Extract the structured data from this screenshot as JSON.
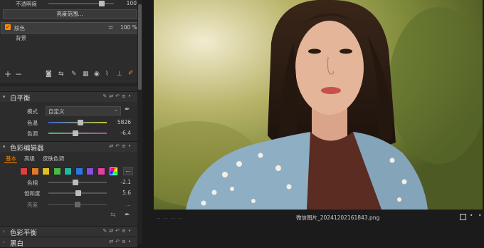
{
  "layer_panel": {
    "opacity_label": "不透明度",
    "opacity_value": "100",
    "opacity_fraction": 0.85,
    "luma_range_button": "亮度范围...",
    "layers": [
      {
        "name": "肤色",
        "opacity": "100 %",
        "selected": true
      },
      {
        "name": "背景",
        "selected": false
      }
    ]
  },
  "white_balance": {
    "title": "白平衡",
    "mode_label": "模式",
    "mode_value": "自定义",
    "temp_label": "色温",
    "temp_value": "5826",
    "temp_fraction": 0.55,
    "tint_label": "色调",
    "tint_value": "-6.4",
    "tint_fraction": 0.46
  },
  "color_editor": {
    "title": "色彩编辑器",
    "tabs": [
      "基本",
      "高级",
      "皮肤色调"
    ],
    "swatches": [
      "#e04040",
      "#e07a28",
      "#e0c020",
      "#4cb848",
      "#20b8a0",
      "#2c78e0",
      "#8c4ce0",
      "#e040a0"
    ],
    "hue_label": "色相",
    "hue_value": "-2.1",
    "hue_fraction": 0.46,
    "sat_label": "饱和度",
    "sat_value": "5.6",
    "sat_fraction": 0.52,
    "light_label": "亮度",
    "light_value": "..."
  },
  "collapsed_sections": [
    {
      "title": "色彩平衡"
    },
    {
      "title": "黑白"
    }
  ],
  "status_bar": {
    "filename": "微信图片_20241202161843.png",
    "left_dots": "..  ..  ..  .."
  },
  "colors": {
    "accent_orange": "#ff8a00",
    "selected_row": "#3d3d3d"
  }
}
